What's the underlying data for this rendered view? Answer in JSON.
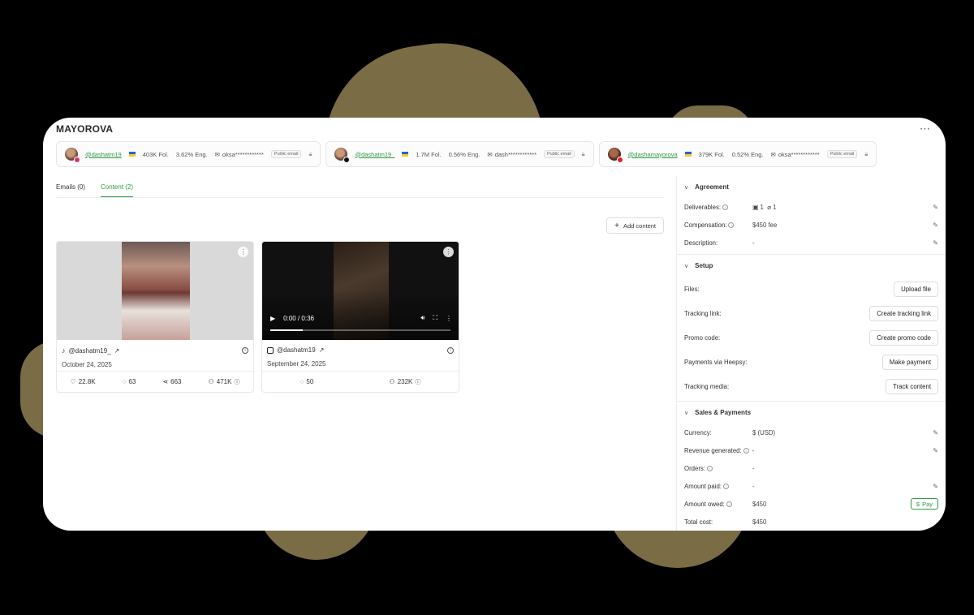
{
  "page": {
    "title": "MAYOROVA",
    "more_icon": "more-horizontal-icon"
  },
  "profiles": [
    {
      "handle": "@dashatm19",
      "platform": "instagram",
      "followers": "403K Fol.",
      "engagement": "3.62% Eng.",
      "email": "oksa************",
      "email_badge": "Public email"
    },
    {
      "handle": "@dashatm19_",
      "platform": "tiktok",
      "followers": "1.7M Fol.",
      "engagement": "0.56% Eng.",
      "email": "dash************",
      "email_badge": "Public email"
    },
    {
      "handle": "@dashamayorova",
      "platform": "youtube",
      "followers": "379K Fol.",
      "engagement": "0.52% Eng.",
      "email": "oksa************",
      "email_badge": "Public email"
    }
  ],
  "tabs": [
    {
      "label": "Emails (0)",
      "active": false
    },
    {
      "label": "Content (2)",
      "active": true
    }
  ],
  "add_content_label": "Add content",
  "posts": [
    {
      "platform": "tiktok",
      "handle": "@dashatm19_",
      "date": "October 24, 2025",
      "likes": "22.8K",
      "comments": "63",
      "shares": "663",
      "reach": "471K"
    },
    {
      "platform": "instagram",
      "handle": "@dashatm19",
      "date": "September 24, 2025",
      "video_time": "0:00 / 0:36",
      "progress": 0.18,
      "comments": "50",
      "reach": "232K"
    }
  ],
  "agreement": {
    "title": "Agreement",
    "deliverables_label": "Deliverables:",
    "deliverables_value_a": "1",
    "deliverables_value_b": "1",
    "compensation_label": "Compensation:",
    "compensation_value": "$450 fee",
    "description_label": "Description:",
    "description_value": "-"
  },
  "setup": {
    "title": "Setup",
    "files_label": "Files:",
    "files_button": "Upload file",
    "tracking_link_label": "Tracking link:",
    "tracking_link_button": "Create tracking link",
    "promo_code_label": "Promo code:",
    "promo_code_button": "Create promo code",
    "payments_label": "Payments via Heepsy:",
    "payments_button": "Make payment",
    "tracking_media_label": "Tracking media:",
    "tracking_media_button": "Track content"
  },
  "sales": {
    "title": "Sales & Payments",
    "currency_label": "Currency:",
    "currency_value": "$ (USD)",
    "revenue_label": "Revenue generated:",
    "revenue_value": "-",
    "orders_label": "Orders:",
    "orders_value": "-",
    "amount_paid_label": "Amount paid:",
    "amount_paid_value": "-",
    "amount_owed_label": "Amount owed:",
    "amount_owed_value": "$450",
    "pay_button": "Pay",
    "total_cost_label": "Total cost:",
    "total_cost_value": "$450"
  },
  "colors": {
    "accent": "#2e9a45",
    "background": "#000000",
    "blob": "#7a6c45"
  }
}
